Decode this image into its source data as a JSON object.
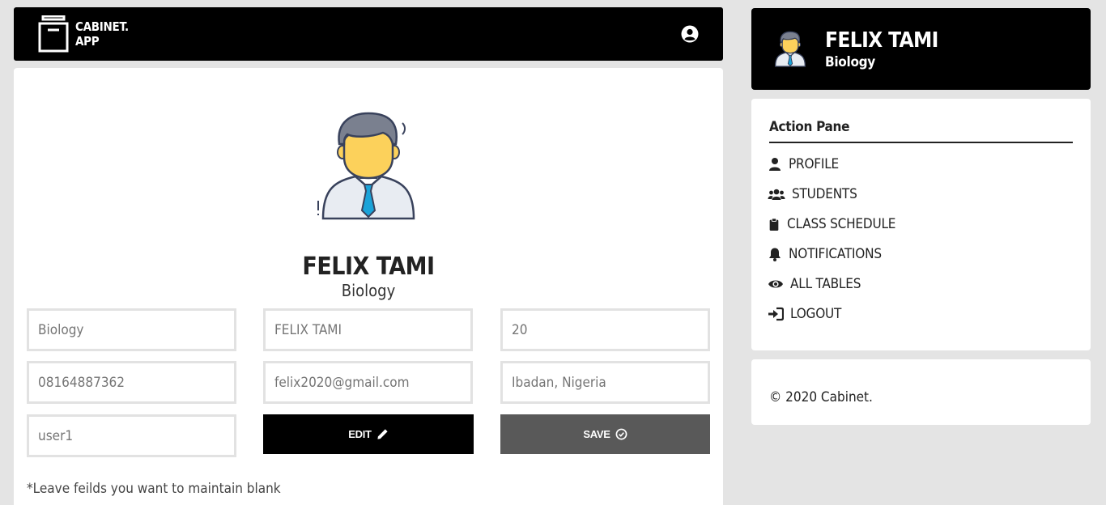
{
  "app": {
    "logo_line1": "CABINET.",
    "logo_line2": "APP"
  },
  "profile": {
    "name": "FELIX TAMI",
    "subject": "Biology"
  },
  "form": {
    "fields": {
      "subject": "Biology",
      "name": "FELIX TAMI",
      "age": "20",
      "phone": "08164887362",
      "email": "felix2020@gmail.com",
      "location": "Ibadan, Nigeria",
      "username": "user1"
    },
    "edit_label": "EDIT",
    "save_label": "SAVE",
    "note": "*Leave feilds you want to maintain blank"
  },
  "sidebar": {
    "pane_title": "Action Pane",
    "items": [
      {
        "label": "PROFILE",
        "icon": "user-icon"
      },
      {
        "label": "STUDENTS",
        "icon": "users-icon"
      },
      {
        "label": "CLASS SCHEDULE",
        "icon": "clipboard-icon"
      },
      {
        "label": "NOTIFICATIONS",
        "icon": "bell-icon"
      },
      {
        "label": "ALL TABLES",
        "icon": "eye-icon"
      },
      {
        "label": "LOGOUT",
        "icon": "sign-in-icon"
      }
    ],
    "copyright": "© 2020 Cabinet."
  },
  "colors": {
    "topbar": "#000000",
    "background": "#e4e4e4",
    "save_button": "#595959",
    "avatar_face": "#fcd15b",
    "avatar_hair": "#7a808f",
    "tie": "#1aa3d9"
  }
}
